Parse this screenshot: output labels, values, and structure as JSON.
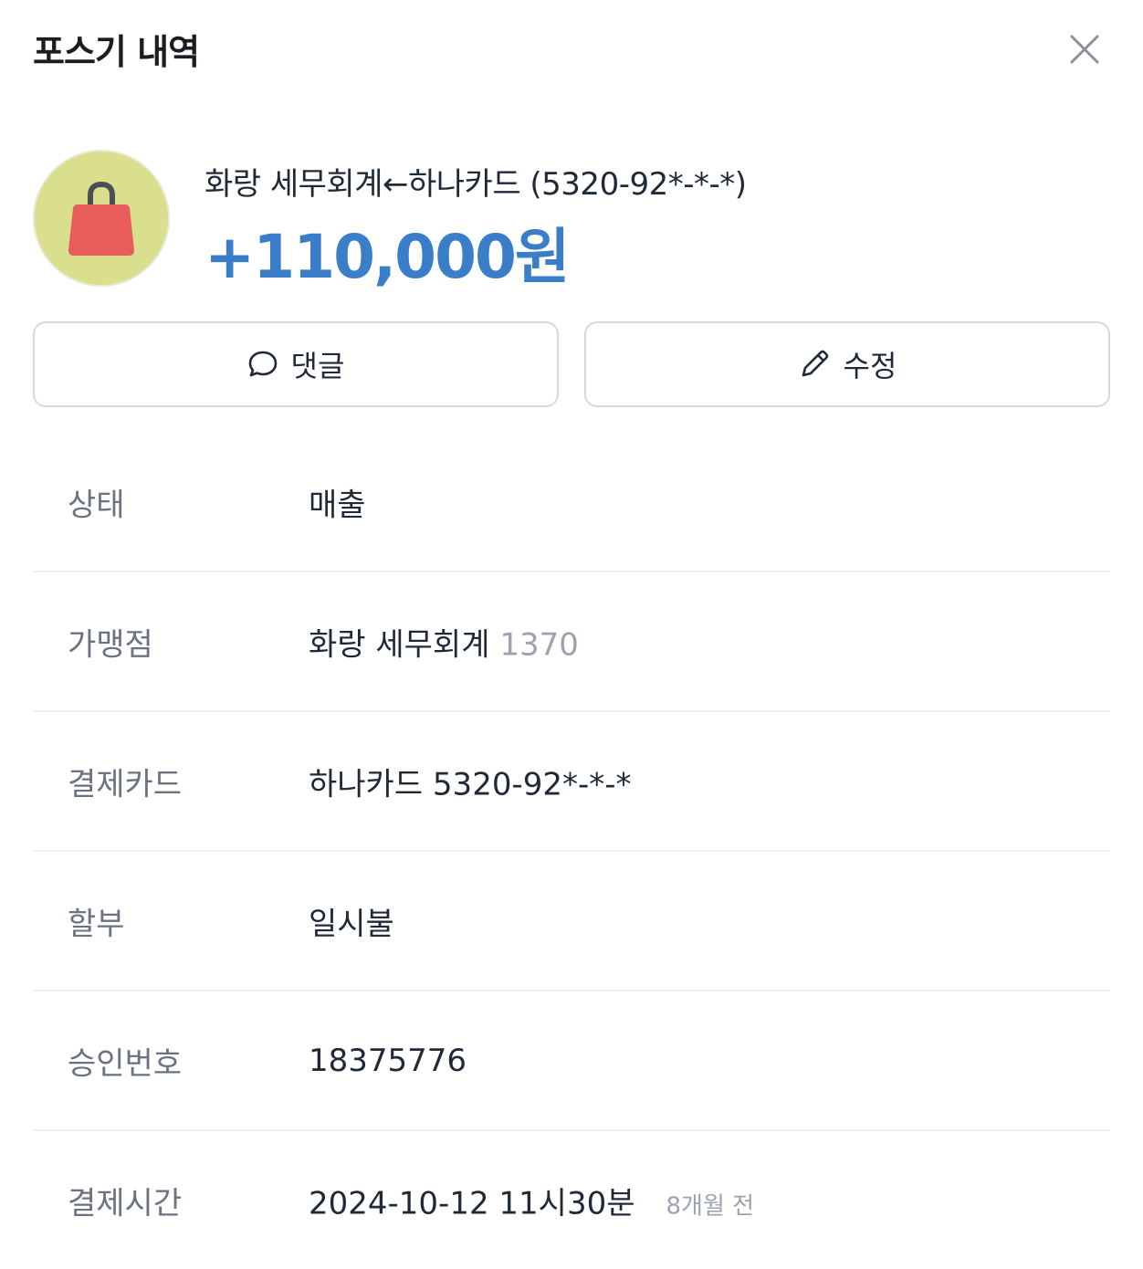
{
  "header": {
    "title": "포스기 내역",
    "close_icon": "close-icon"
  },
  "summary": {
    "avatar_icon": "shopping-bag-icon",
    "avatar_bg_color": "#d9df8c",
    "bag_color": "#e85c5c",
    "description": "화랑 세무회계←하나카드 (5320-92*-*-*)",
    "amount": "+110,000원",
    "amount_color": "#3a7ec9"
  },
  "actions": {
    "comment_label": "댓글",
    "comment_icon": "speech-bubble-icon",
    "edit_label": "수정",
    "edit_icon": "pencil-icon"
  },
  "details": {
    "status": {
      "label": "상태",
      "value": "매출"
    },
    "merchant": {
      "label": "가맹점",
      "value": "화랑 세무회계",
      "sub": "1370"
    },
    "card": {
      "label": "결제카드",
      "value": "하나카드 5320-92*-*-*"
    },
    "installment": {
      "label": "할부",
      "value": "일시불"
    },
    "approval": {
      "label": "승인번호",
      "value": "18375776"
    },
    "paid_at": {
      "label": "결제시간",
      "value": "2024-10-12 11시30분",
      "relative": "8개월 전"
    }
  }
}
